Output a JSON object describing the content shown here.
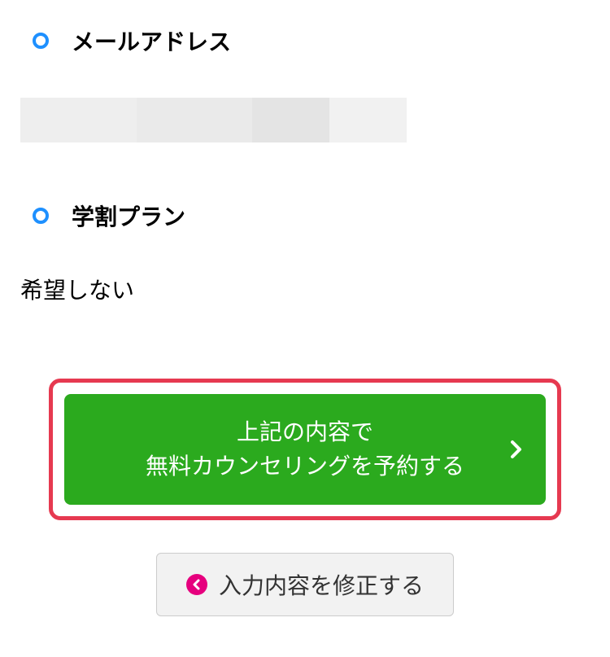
{
  "sections": {
    "email": {
      "title": "メールアドレス",
      "value": ""
    },
    "plan": {
      "title": "学割プラン",
      "value": "希望しない"
    }
  },
  "buttons": {
    "primary_line1": "上記の内容で",
    "primary_line2": "無料カウンセリングを予約する",
    "secondary": "入力内容を修正する"
  }
}
